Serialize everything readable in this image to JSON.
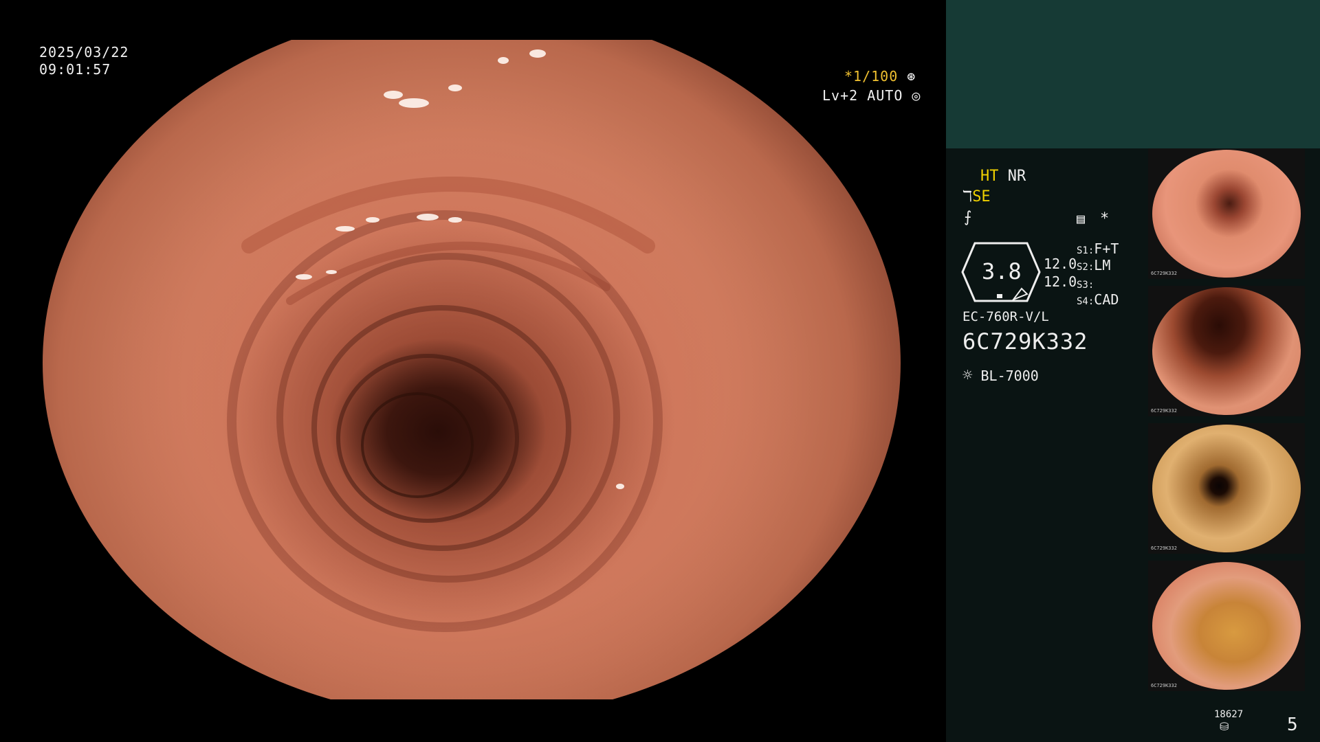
{
  "overlay": {
    "date": "2025/03/22",
    "time": "09:01:57",
    "shutter": "*1/100",
    "level": "Lv+2 AUTO"
  },
  "panel": {
    "ht": "HT",
    "nr": "NR",
    "se": "SE",
    "zoom_value": "3.8",
    "val1": "12.0",
    "val2": "12.0",
    "s1_label": "S1:",
    "s1_value": "F+T",
    "s2_label": "S2:",
    "s2_value": "LM",
    "s3_label": "S3:",
    "s3_value": "",
    "s4_label": "S4:",
    "s4_value": "CAD",
    "asterisk": "*",
    "scope_model": "EC-760R-V/L",
    "serial": "6C729K332",
    "light_source": "BL-7000",
    "counter": "18627",
    "image_count": "5"
  },
  "thumbnails": [
    {
      "serial": "6C729K332",
      "tone": "pink"
    },
    {
      "serial": "6C729K332",
      "tone": "dark"
    },
    {
      "serial": "6C729K332",
      "tone": "yellow"
    },
    {
      "serial": "6C729K332",
      "tone": "orange"
    }
  ],
  "colors": {
    "panel_top": "#163a35",
    "panel_bg": "#0a1413",
    "accent_yellow": "#f0d000"
  }
}
